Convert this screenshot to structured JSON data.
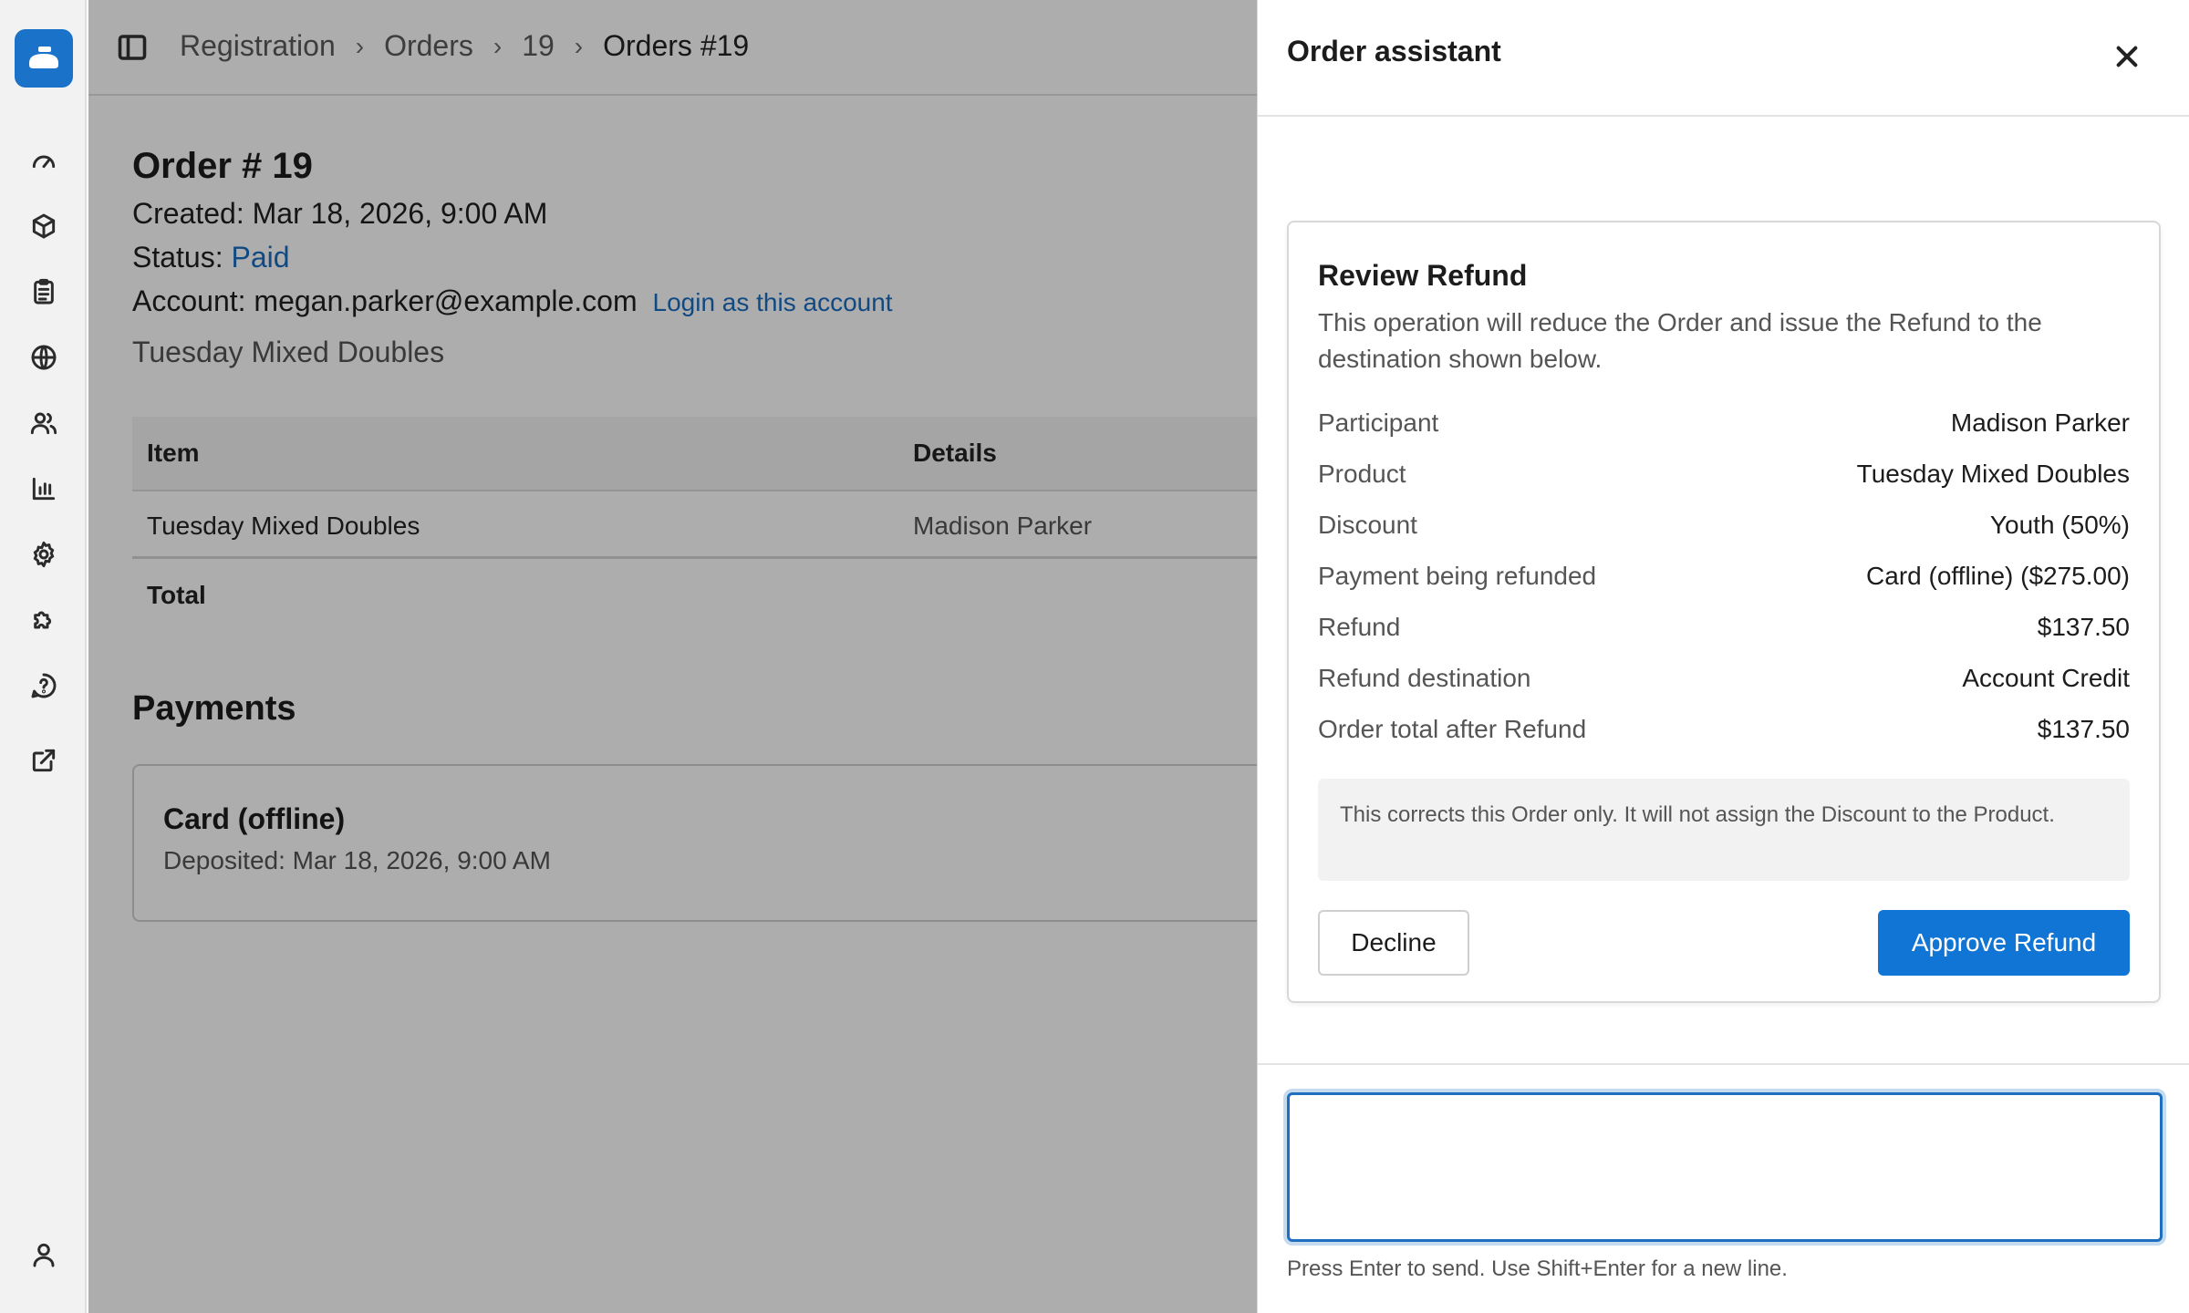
{
  "breadcrumb": {
    "items": [
      "Registration",
      "Orders",
      "19"
    ],
    "current": "Orders #19",
    "separator": "›"
  },
  "order": {
    "title": "Order # 19",
    "created_label": "Created:",
    "created_value": "Mar 18, 2026, 9:00 AM",
    "status_label": "Status:",
    "status_value": "Paid",
    "account_label": "Account:",
    "account_value": "megan.parker@example.com",
    "login_link": "Login as this account",
    "product": "Tuesday Mixed Doubles"
  },
  "table": {
    "headers": [
      "Item",
      "Details"
    ],
    "rows": [
      {
        "item": "Tuesday Mixed Doubles",
        "details": "Madison Parker"
      }
    ],
    "total_label": "Total"
  },
  "payments": {
    "title": "Payments",
    "card_title": "Card (offline)",
    "card_detail": "Deposited: Mar 18, 2026, 9:00 AM"
  },
  "drawer": {
    "title": "Order assistant",
    "refund": {
      "title": "Review Refund",
      "description": "This operation will reduce the Order and issue the Refund to the destination shown below.",
      "rows": [
        {
          "label": "Participant",
          "value": "Madison Parker"
        },
        {
          "label": "Product",
          "value": "Tuesday Mixed Doubles"
        },
        {
          "label": "Discount",
          "value": "Youth (50%)"
        },
        {
          "label": "Payment being refunded",
          "value": "Card (offline) ($275.00)"
        },
        {
          "label": "Refund",
          "value": "$137.50"
        },
        {
          "label": "Refund destination",
          "value": "Account Credit"
        },
        {
          "label": "Order total after Refund",
          "value": "$137.50"
        }
      ],
      "note": "This corrects this Order only. It will not assign the Discount to the Product.",
      "decline_label": "Decline",
      "approve_label": "Approve Refund"
    },
    "compose_value": "",
    "hint": "Press Enter to send. Use Shift+Enter for a new line."
  },
  "colors": {
    "brand": "#1a73c9",
    "link": "#1a6dc2",
    "primary_button": "#1075d4",
    "focus_ring": "#1e6fc0"
  },
  "icons": {
    "sidebar": [
      "gauge-icon",
      "package-icon",
      "clipboard-list-icon",
      "globe-icon",
      "users-icon",
      "bar-chart-icon",
      "gear-icon",
      "puzzle-icon",
      "help-circle-icon",
      "external-link-icon",
      "user-icon"
    ],
    "logo": "curling-stone-icon",
    "panel": "sidebar-toggle-icon",
    "close": "close-icon"
  }
}
